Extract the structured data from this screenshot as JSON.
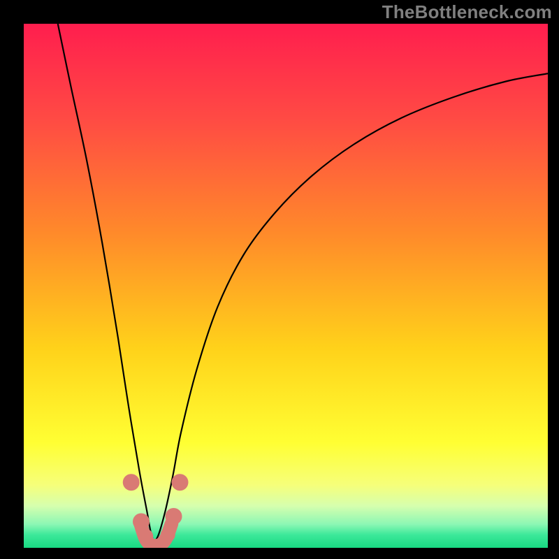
{
  "watermark": "TheBottleneck.com",
  "chart_data": {
    "type": "line",
    "title": "",
    "xlabel": "",
    "ylabel": "",
    "xlim": [
      0,
      100
    ],
    "ylim": [
      0,
      100
    ],
    "background_gradient_stops": [
      {
        "offset": 0.0,
        "color": "#ff1e4e"
      },
      {
        "offset": 0.18,
        "color": "#ff4a44"
      },
      {
        "offset": 0.4,
        "color": "#ff8a2a"
      },
      {
        "offset": 0.62,
        "color": "#ffd21a"
      },
      {
        "offset": 0.8,
        "color": "#ffff33"
      },
      {
        "offset": 0.88,
        "color": "#f6ff7a"
      },
      {
        "offset": 0.92,
        "color": "#d6ffae"
      },
      {
        "offset": 0.955,
        "color": "#8cf7b4"
      },
      {
        "offset": 0.975,
        "color": "#3de89a"
      },
      {
        "offset": 1.0,
        "color": "#18da82"
      }
    ],
    "series": [
      {
        "name": "bottleneck-curve",
        "comment": "Piecewise: left branch falls steeply from x≈6,y=100 to minimum near x≈25,y≈0; right branch rises with decreasing slope toward x=100,y≈90.",
        "x": [
          6.5,
          9,
          12,
          15,
          18,
          20,
          22,
          23.5,
          24.5,
          25.5,
          27,
          28.5,
          30,
          33,
          37,
          42,
          48,
          55,
          63,
          72,
          82,
          92,
          100
        ],
        "y": [
          100,
          88,
          74,
          58,
          40,
          27,
          15,
          7,
          2,
          2,
          7,
          14,
          22,
          34,
          46,
          56,
          64,
          71,
          77,
          82,
          86,
          89,
          90.5
        ]
      }
    ],
    "markers": [
      {
        "name": "left-upper-dot",
        "x": 20.5,
        "y": 12.5,
        "r": 1.6,
        "color": "#d97a74"
      },
      {
        "name": "left-mid-dot",
        "x": 22.4,
        "y": 5.0,
        "r": 1.6,
        "color": "#d97a74"
      },
      {
        "name": "left-lower-dot",
        "x": 23.3,
        "y": 2.2,
        "r": 1.4,
        "color": "#d97a74"
      },
      {
        "name": "right-lower-dot",
        "x": 27.5,
        "y": 2.5,
        "r": 1.4,
        "color": "#d97a74"
      },
      {
        "name": "right-mid-dot",
        "x": 28.6,
        "y": 6.0,
        "r": 1.6,
        "color": "#d97a74"
      },
      {
        "name": "right-upper-dot",
        "x": 29.8,
        "y": 12.5,
        "r": 1.6,
        "color": "#d97a74"
      }
    ],
    "trough_band": {
      "comment": "Thick salmon U arc at curve bottom",
      "x": [
        22.3,
        23.2,
        24.2,
        25.2,
        26.2,
        27.2,
        28.2
      ],
      "y": [
        4.5,
        1.8,
        0.6,
        0.4,
        0.7,
        1.9,
        4.6
      ],
      "color": "#d97a74",
      "width": 2.6
    }
  }
}
